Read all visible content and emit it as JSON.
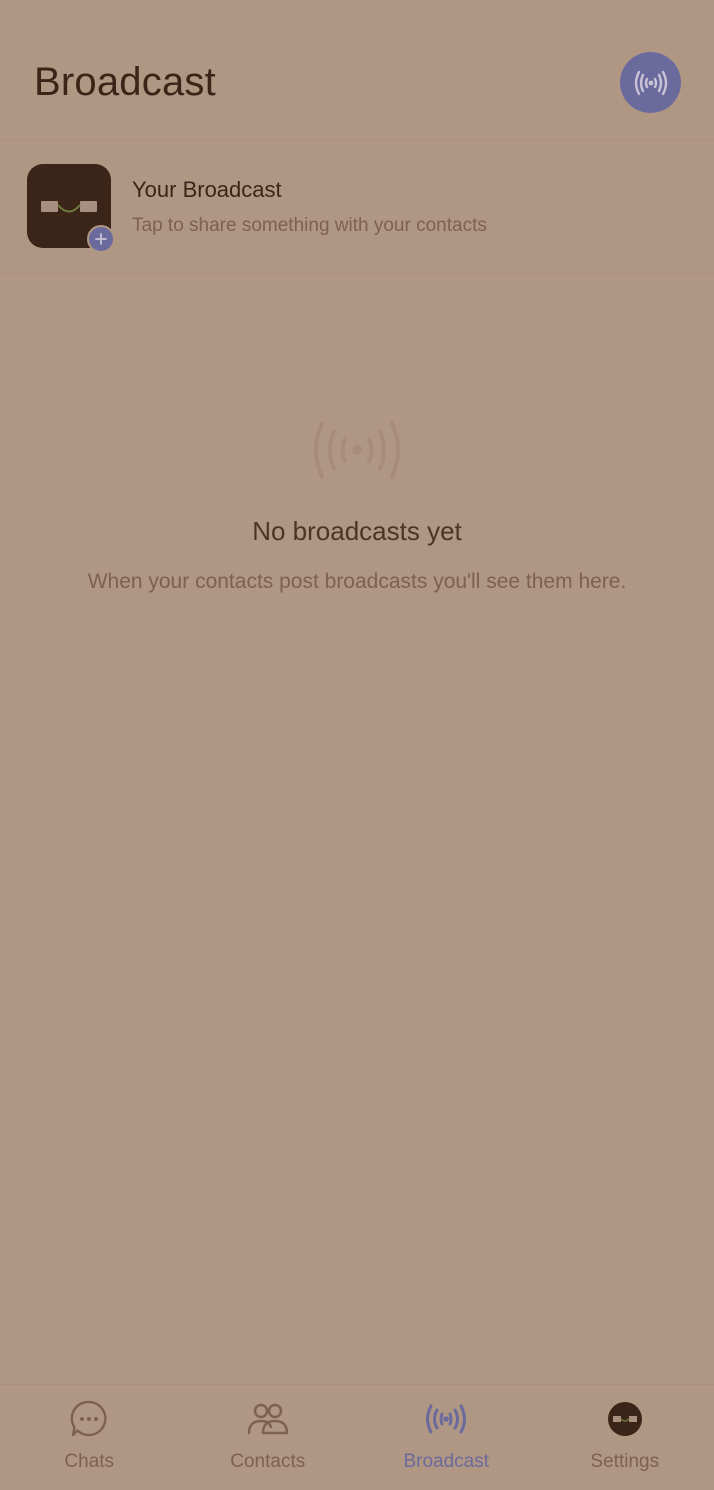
{
  "header": {
    "title": "Broadcast",
    "action_icon": "broadcast-icon"
  },
  "my_broadcast": {
    "title": "Your Broadcast",
    "subtitle": "Tap to share something with your contacts",
    "badge_icon": "plus-icon"
  },
  "empty_state": {
    "icon": "broadcast-icon",
    "title": "No broadcasts yet",
    "description": "When your contacts post broadcasts you'll see them here."
  },
  "nav": {
    "items": [
      {
        "label": "Chats",
        "icon": "chat-bubble-icon",
        "active": false
      },
      {
        "label": "Contacts",
        "icon": "contacts-icon",
        "active": false
      },
      {
        "label": "Broadcast",
        "icon": "broadcast-icon",
        "active": true
      },
      {
        "label": "Settings",
        "icon": "avatar-icon",
        "active": false
      }
    ]
  },
  "colors": {
    "background": "#b09784",
    "accent": "#6b6a9d",
    "text_primary": "#3e2418",
    "text_secondary": "#7c6152",
    "avatar_bg": "#3b2418"
  }
}
